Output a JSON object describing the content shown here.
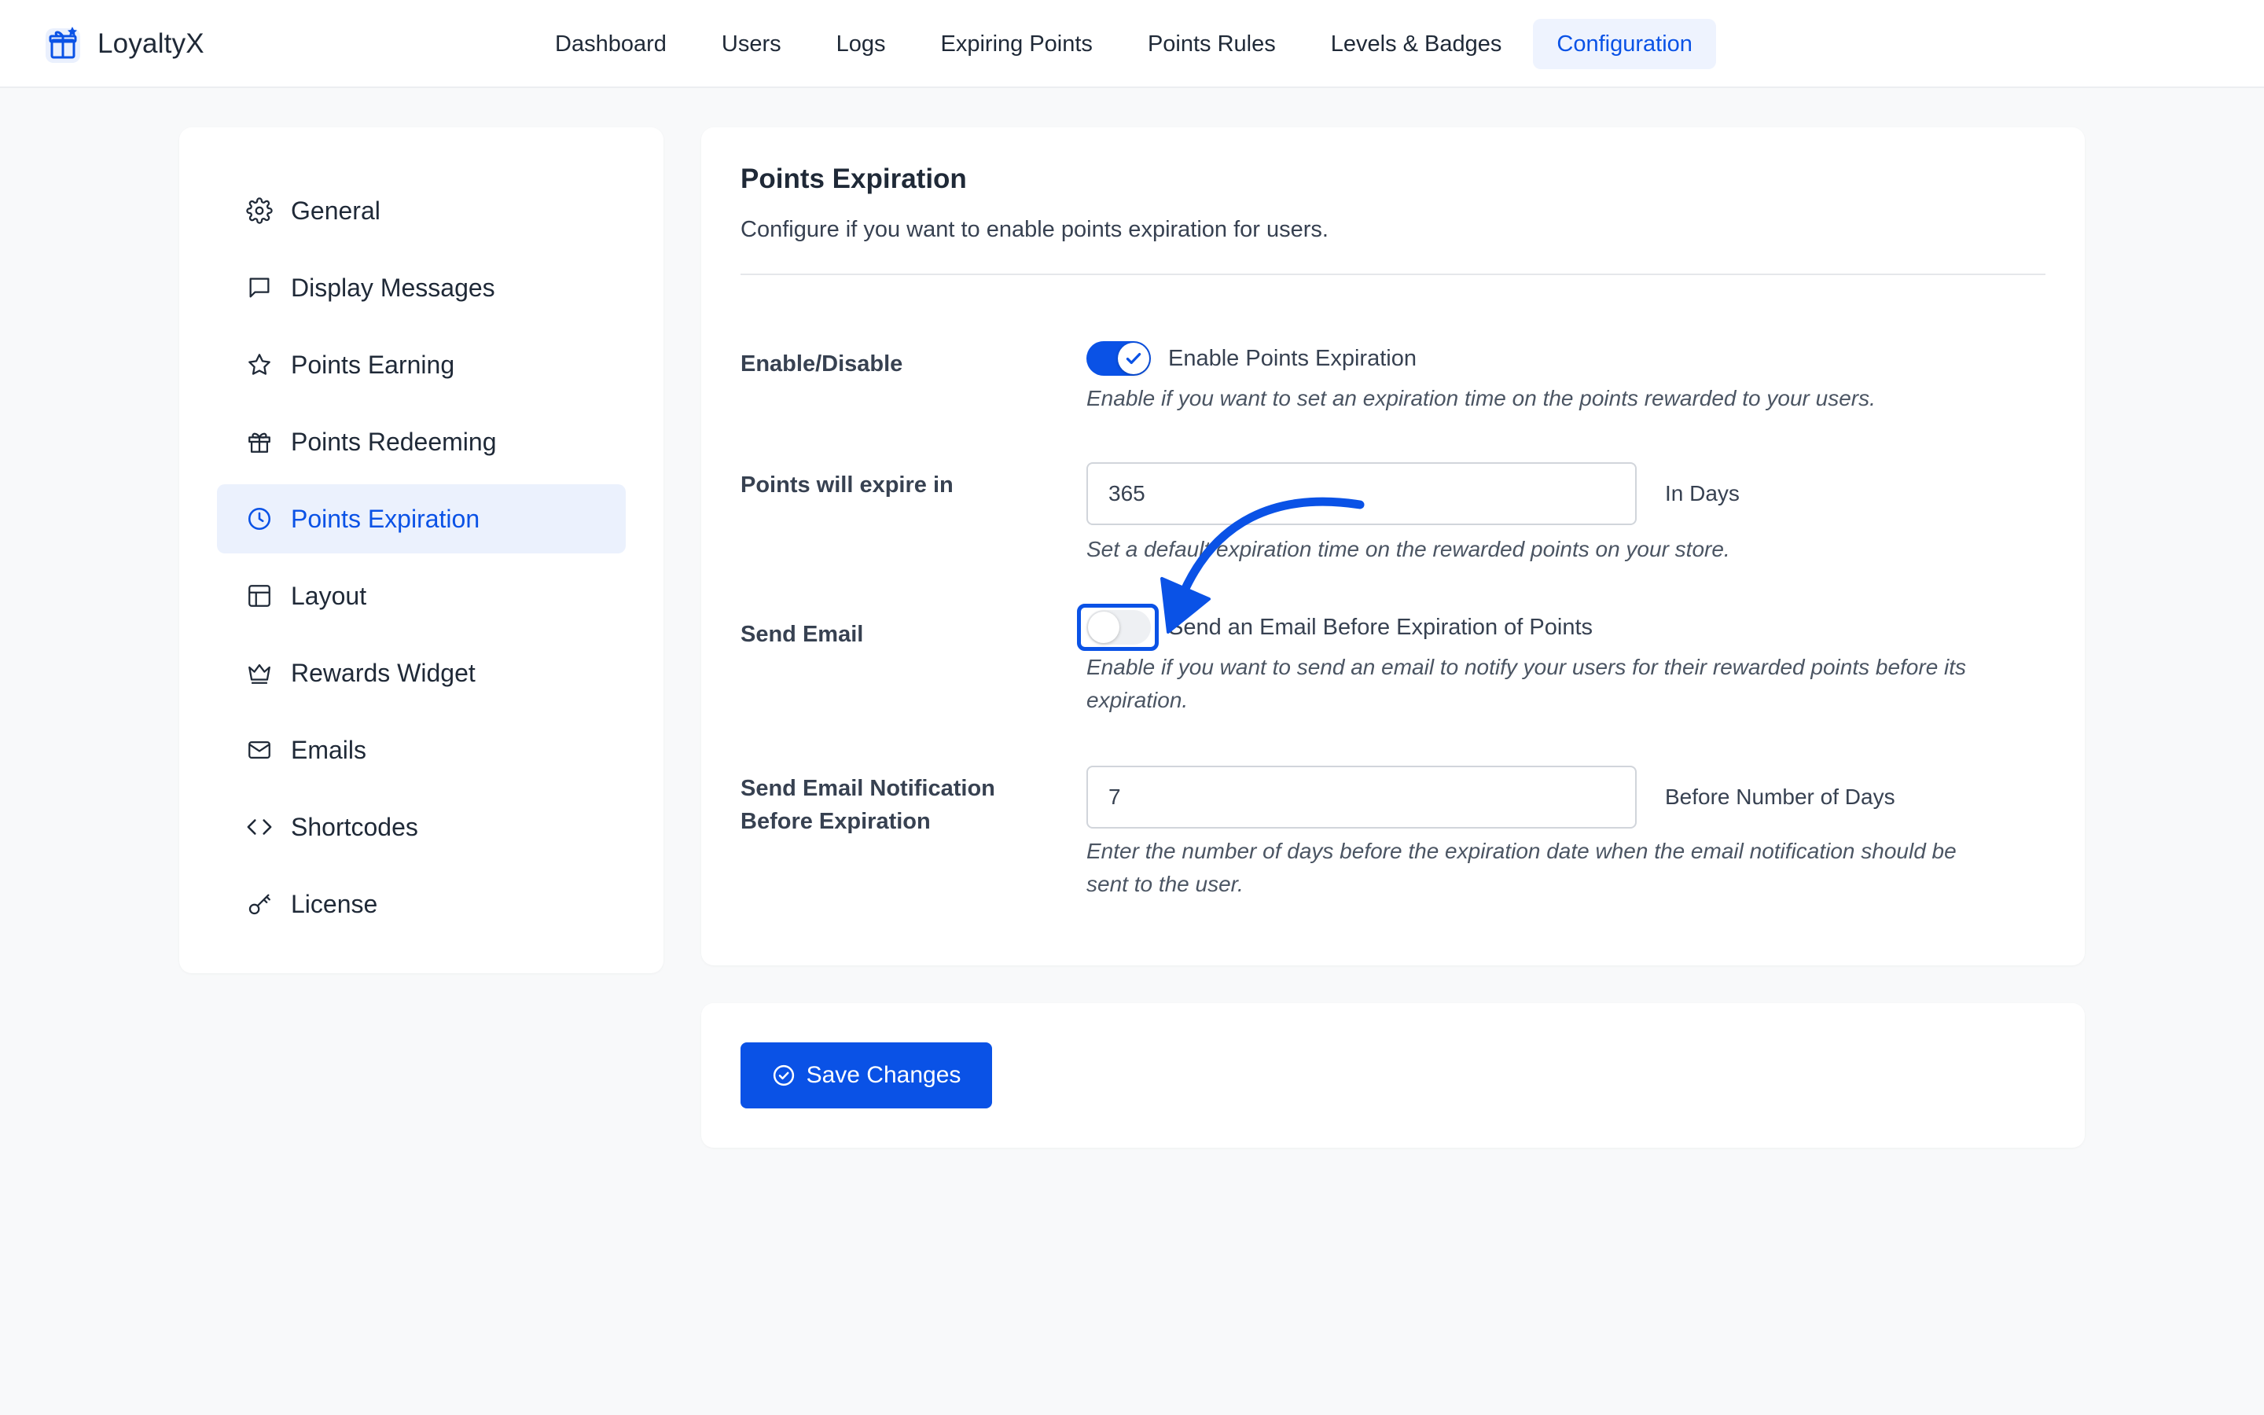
{
  "app": {
    "name": "LoyaltyX"
  },
  "nav": {
    "items": [
      {
        "label": "Dashboard"
      },
      {
        "label": "Users"
      },
      {
        "label": "Logs"
      },
      {
        "label": "Expiring Points"
      },
      {
        "label": "Points Rules"
      },
      {
        "label": "Levels & Badges"
      },
      {
        "label": "Configuration",
        "active": true
      }
    ]
  },
  "sidebar": {
    "items": [
      {
        "label": "General",
        "icon": "gear-icon"
      },
      {
        "label": "Display Messages",
        "icon": "message-icon"
      },
      {
        "label": "Points Earning",
        "icon": "star-icon"
      },
      {
        "label": "Points Redeeming",
        "icon": "gift-icon"
      },
      {
        "label": "Points Expiration",
        "icon": "clock-icon",
        "active": true
      },
      {
        "label": "Layout",
        "icon": "layout-icon"
      },
      {
        "label": "Rewards Widget",
        "icon": "crown-icon"
      },
      {
        "label": "Emails",
        "icon": "mail-icon"
      },
      {
        "label": "Shortcodes",
        "icon": "code-icon"
      },
      {
        "label": "License",
        "icon": "key-icon"
      }
    ]
  },
  "section": {
    "title": "Points Expiration",
    "description": "Configure if you want to enable points expiration for users."
  },
  "fields": {
    "enable": {
      "label": "Enable/Disable",
      "toggle_label": "Enable Points Expiration",
      "enabled": true,
      "help": "Enable if you want to set an expiration time on the points rewarded to your users."
    },
    "expire": {
      "label": "Points will expire in",
      "value": "365",
      "unit": "In Days",
      "help": "Set a default expiration time on the rewarded points on your store."
    },
    "send_email": {
      "label": "Send Email",
      "toggle_label": "Send an Email Before Expiration of Points",
      "enabled": false,
      "help_line1": "Enable if you want to send an email to notify your users for their rewarded points before its",
      "help_line2": "expiration."
    },
    "notify_before": {
      "label_line1": "Send Email Notification",
      "label_line2": "Before Expiration",
      "value": "7",
      "unit": "Before Number of Days",
      "help_line1": "Enter the number of days before the expiration date when the email notification should be",
      "help_line2": "sent to the user."
    }
  },
  "actions": {
    "save_label": "Save Changes"
  },
  "colors": {
    "accent": "#0a52e6",
    "active_bg": "#ebf1fd",
    "page_bg": "#f8f9fa"
  }
}
